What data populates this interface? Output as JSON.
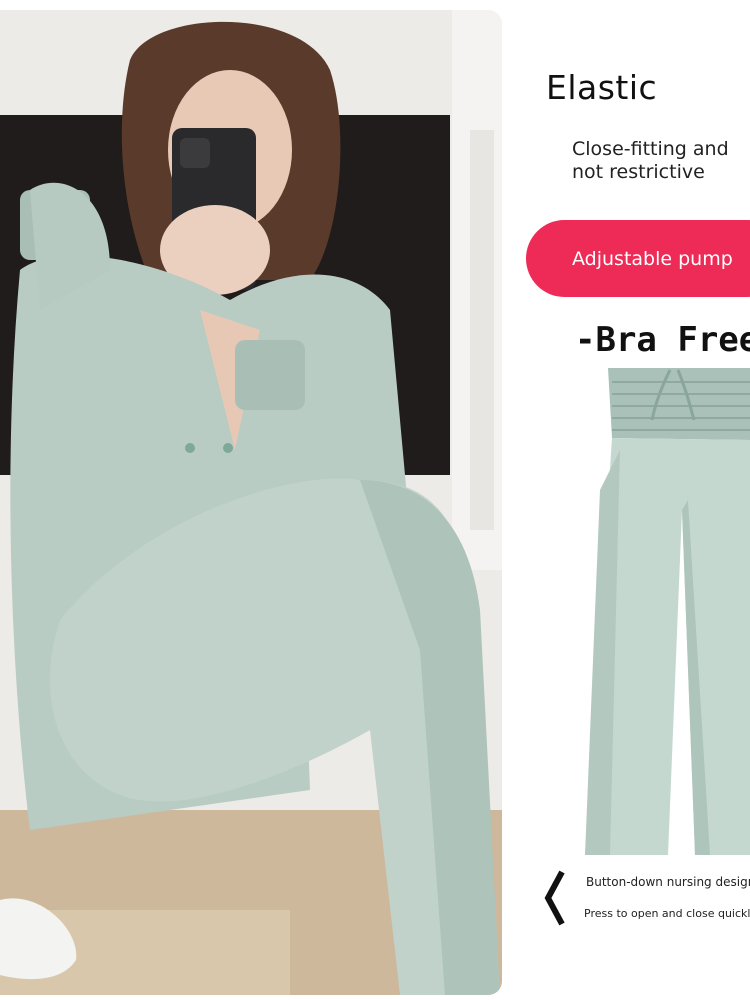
{
  "headline": "Elastic",
  "subheadline": "Close-fitting and not restrictive",
  "badge": {
    "label": "Adjustable pump",
    "color": "#ee2a56"
  },
  "feature_tag": "-Bra Free",
  "captions": {
    "line1": "Button-down nursing design",
    "line2": "Press to open and close quickly"
  },
  "icons": {
    "arrow": "chevron-left-icon"
  },
  "colors": {
    "garment": "#b8ccc4",
    "garment_shadow": "#9fb5ac"
  }
}
